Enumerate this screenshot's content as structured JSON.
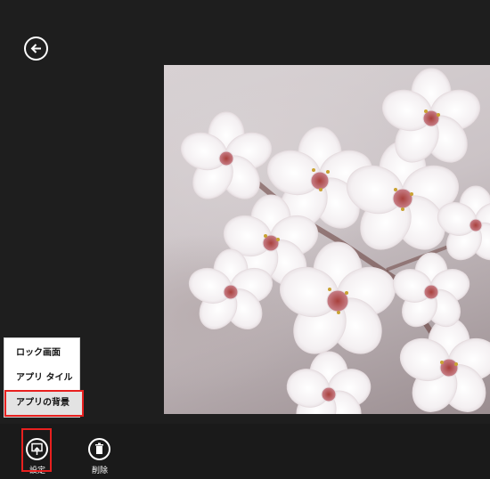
{
  "back_button": {
    "icon": "back-arrow-icon"
  },
  "photo": {
    "subject": "cherry-blossom-photo"
  },
  "context_menu": {
    "items": [
      {
        "label": "ロック画面"
      },
      {
        "label": "アプリ タイル"
      },
      {
        "label": "アプリの背景"
      }
    ]
  },
  "app_bar": {
    "set_button": {
      "label": "設定",
      "icon": "set-as-icon"
    },
    "delete_button": {
      "label": "削除",
      "icon": "trash-icon"
    }
  },
  "colors": {
    "background": "#1e1e1e",
    "highlight": "#e8201f",
    "menu_bg": "#ffffff"
  }
}
